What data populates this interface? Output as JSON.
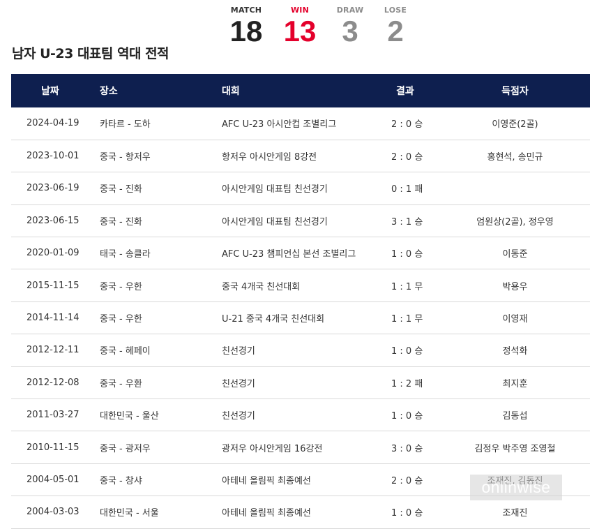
{
  "title": "남자 U-23 대표팀 역대 전적",
  "scoreboard": {
    "match": {
      "label": "MATCH",
      "value": "18",
      "color": "#222222"
    },
    "win": {
      "label": "WIN",
      "value": "13",
      "color": "#e4002b"
    },
    "draw": {
      "label": "DRAW",
      "value": "3",
      "color": "#8c8c8c"
    },
    "lose": {
      "label": "LOSE",
      "value": "2",
      "color": "#8c8c8c"
    }
  },
  "table": {
    "headers": {
      "date": "날짜",
      "venue": "장소",
      "competition": "대회",
      "result": "결과",
      "scorers": "득점자"
    },
    "rows": [
      {
        "date": "2024-04-19",
        "venue": "카타르 - 도하",
        "competition": "AFC U-23 아시안컵 조별리그",
        "result": "2 : 0 승",
        "scorers": "이영준(2골)"
      },
      {
        "date": "2023-10-01",
        "venue": "중국 - 항저우",
        "competition": "항저우 아시안게임 8강전",
        "result": "2 : 0 승",
        "scorers": "홍현석, 송민규"
      },
      {
        "date": "2023-06-19",
        "venue": "중국 - 진화",
        "competition": "아시안게임 대표팀 친선경기",
        "result": "0 : 1 패",
        "scorers": ""
      },
      {
        "date": "2023-06-15",
        "venue": "중국 - 진화",
        "competition": "아시안게임 대표팀 친선경기",
        "result": "3 : 1 승",
        "scorers": "엄원상(2골), 정우영"
      },
      {
        "date": "2020-01-09",
        "venue": "태국 - 송클라",
        "competition": "AFC U-23 챔피언십 본선 조별리그",
        "result": "1 : 0 승",
        "scorers": "이동준"
      },
      {
        "date": "2015-11-15",
        "venue": "중국 - 우한",
        "competition": "중국 4개국 친선대회",
        "result": "1 : 1 무",
        "scorers": "박용우"
      },
      {
        "date": "2014-11-14",
        "venue": "중국 - 우한",
        "competition": "U-21 중국 4개국 친선대회",
        "result": "1 : 1 무",
        "scorers": "이영재"
      },
      {
        "date": "2012-12-11",
        "venue": "중국 - 헤페이",
        "competition": "친선경기",
        "result": "1 : 0 승",
        "scorers": "정석화"
      },
      {
        "date": "2012-12-08",
        "venue": "중국 - 우환",
        "competition": "친선경기",
        "result": "1 : 2 패",
        "scorers": "최지훈"
      },
      {
        "date": "2011-03-27",
        "venue": "대한민국 - 울산",
        "competition": "친선경기",
        "result": "1 : 0 승",
        "scorers": "김동섭"
      },
      {
        "date": "2010-11-15",
        "venue": "중국 - 광저우",
        "competition": "광저우 아시안게임 16강전",
        "result": "3 : 0 승",
        "scorers": "김정우 박주영 조영철"
      },
      {
        "date": "2004-05-01",
        "venue": "중국 - 창샤",
        "competition": "아테네 올림픽 최종예선",
        "result": "2 : 0 승",
        "scorers": "조재진, 김동진"
      },
      {
        "date": "2004-03-03",
        "venue": "대한민국 - 서울",
        "competition": "아테네 올림픽 최종예선",
        "result": "1 : 0 승",
        "scorers": "조재진"
      }
    ]
  },
  "watermark": "onlinwise",
  "colors": {
    "header_bg": "#0e1f4f",
    "win_red": "#e4002b",
    "grey": "#8c8c8c"
  }
}
